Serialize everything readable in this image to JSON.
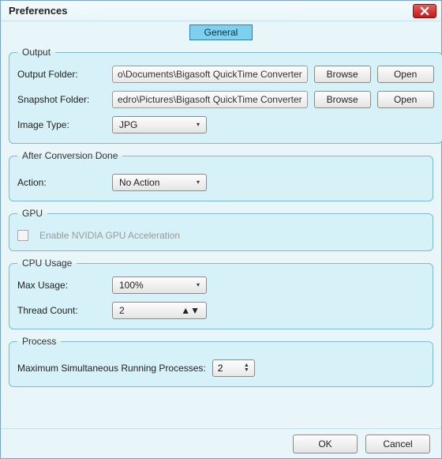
{
  "window": {
    "title": "Preferences"
  },
  "tabs": {
    "general": "General"
  },
  "output": {
    "legend": "Output",
    "output_folder_label": "Output Folder:",
    "output_folder_value": "o\\Documents\\Bigasoft QuickTime Converter",
    "snapshot_folder_label": "Snapshot Folder:",
    "snapshot_folder_value": "edro\\Pictures\\Bigasoft QuickTime Converter",
    "image_type_label": "Image Type:",
    "image_type_value": "JPG",
    "browse": "Browse",
    "open": "Open"
  },
  "after": {
    "legend": "After Conversion Done",
    "action_label": "Action:",
    "action_value": "No Action"
  },
  "gpu": {
    "legend": "GPU",
    "checkbox_label": "Enable NVIDIA GPU Acceleration"
  },
  "cpu": {
    "legend": "CPU Usage",
    "max_usage_label": "Max Usage:",
    "max_usage_value": "100%",
    "thread_count_label": "Thread Count:",
    "thread_count_value": "2"
  },
  "process": {
    "legend": "Process",
    "max_proc_label": "Maximum Simultaneous Running Processes:",
    "max_proc_value": "2"
  },
  "footer": {
    "ok": "OK",
    "cancel": "Cancel"
  }
}
